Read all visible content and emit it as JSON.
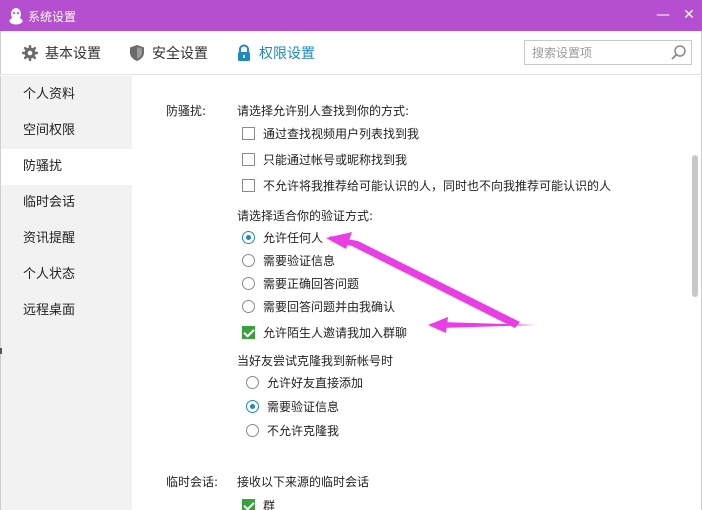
{
  "window": {
    "title": "系统设置",
    "minimize_glyph": "—",
    "close_glyph": "✕"
  },
  "toolbar": {
    "tabs": [
      {
        "label": "基本设置",
        "icon": "gear-icon"
      },
      {
        "label": "安全设置",
        "icon": "shield-icon"
      },
      {
        "label": "权限设置",
        "icon": "lock-icon",
        "active": true
      }
    ],
    "search": {
      "placeholder": "搜索设置项",
      "value": ""
    }
  },
  "sidebar": {
    "items": [
      {
        "label": "个人资料"
      },
      {
        "label": "空间权限"
      },
      {
        "label": "防骚扰",
        "active": true
      },
      {
        "label": "临时会话"
      },
      {
        "label": "资讯提醒"
      },
      {
        "label": "个人状态"
      },
      {
        "label": "远程桌面"
      }
    ]
  },
  "anti_harass": {
    "section_label": "防骚扰:",
    "find_prompt": "请选择允许别人查找到你的方式:",
    "find_options": [
      {
        "label": "通过查找视频用户列表找到我",
        "checked": false
      },
      {
        "label": "只能通过帐号或昵称找到我",
        "checked": false
      },
      {
        "label": "不允许将我推荐给可能认识的人，同时也不向我推荐可能认识的人",
        "checked": false
      }
    ],
    "verify_prompt": "请选择适合你的验证方式:",
    "verify_options": [
      {
        "label": "允许任何人",
        "selected": true
      },
      {
        "label": "需要验证信息",
        "selected": false
      },
      {
        "label": "需要正确回答问题",
        "selected": false
      },
      {
        "label": "需要回答问题并由我确认",
        "selected": false
      }
    ],
    "group_invite": {
      "label": "允许陌生人邀请我加入群聊",
      "checked": true
    },
    "clone_prompt": "当好友尝试克隆我到新帐号时",
    "clone_options": [
      {
        "label": "允许好友直接添加",
        "selected": false
      },
      {
        "label": "需要验证信息",
        "selected": true
      },
      {
        "label": "不允许克隆我",
        "selected": false
      }
    ]
  },
  "temp_chat": {
    "section_label": "临时会话:",
    "prompt": "接收以下来源的临时会话",
    "options": [
      {
        "label": "群",
        "checked": true
      }
    ]
  },
  "colors": {
    "titlebar": "#b44fd0",
    "accent": "#1e88c9",
    "check_green": "#3aa23a",
    "annotation_arrow": "#ea3de6"
  }
}
